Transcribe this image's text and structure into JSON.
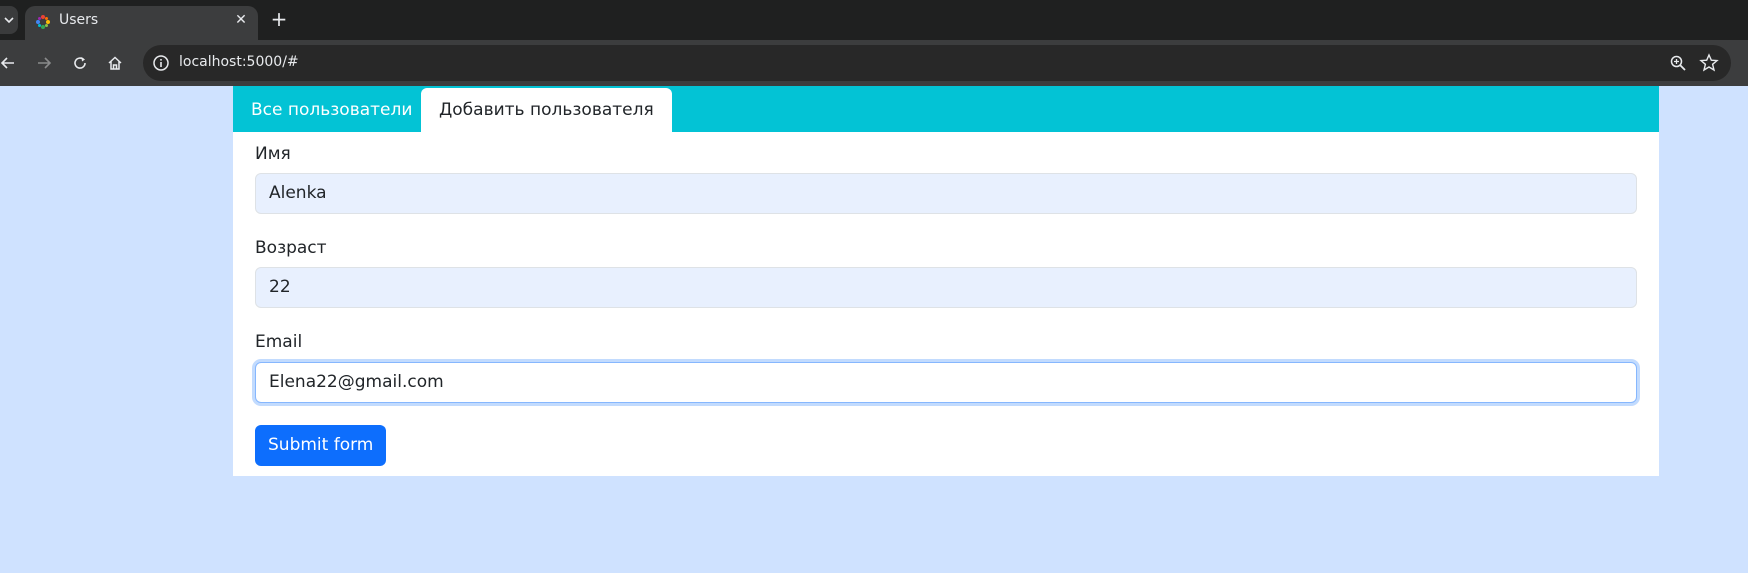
{
  "browser": {
    "tab_title": "Users",
    "url": "localhost:5000/#",
    "new_tab_glyph": "+",
    "close_glyph": "✕",
    "icons": [
      "tab-menu-icon",
      "favicon-icon",
      "close-icon",
      "new-tab-icon",
      "back-icon",
      "forward-icon",
      "reload-icon",
      "home-icon",
      "site-info-icon",
      "zoom-icon",
      "bookmark-star-icon"
    ]
  },
  "nav": {
    "tabs": [
      {
        "label": "Все пользователи",
        "active": false
      },
      {
        "label": "Добавить пользователя",
        "active": true
      }
    ]
  },
  "form": {
    "fields": [
      {
        "label": "Имя",
        "value": "Alenka"
      },
      {
        "label": "Возраст",
        "value": "22"
      },
      {
        "label": "Email",
        "value": "Elena22@gmail.com"
      }
    ],
    "submit_label": "Submit form"
  },
  "colors": {
    "page_bg": "#cfe2ff",
    "nav_bg": "#03c3d5",
    "primary": "#0d6efd",
    "autofill_bg": "#e8f0fe"
  }
}
